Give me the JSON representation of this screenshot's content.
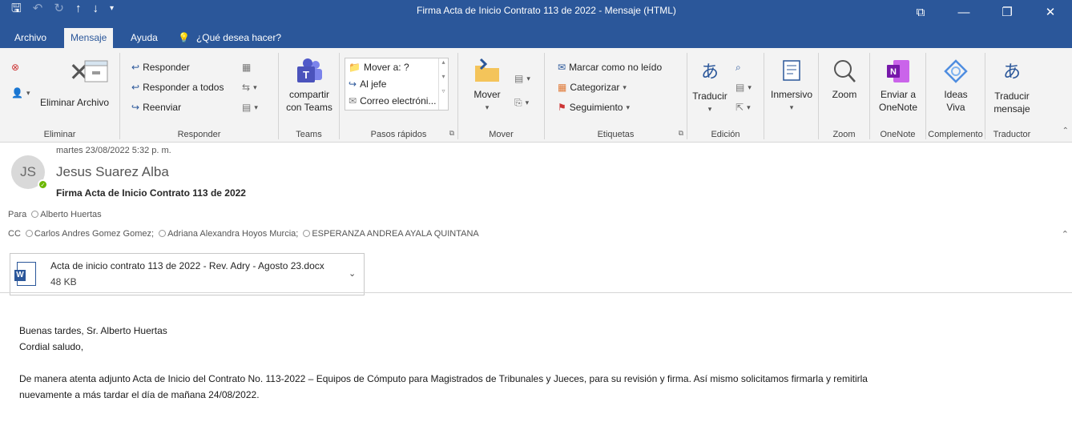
{
  "window": {
    "title": "Firma Acta de Inicio Contrato 113 de 2022  -  Mensaje (HTML)"
  },
  "tabs": {
    "archivo": "Archivo",
    "mensaje": "Mensaje",
    "ayuda": "Ayuda",
    "tell_me": "¿Qué desea hacer?"
  },
  "ribbon": {
    "eliminar": {
      "delete_label": "Eliminar Archivo",
      "group": "Eliminar"
    },
    "responder": {
      "reply": "Responder",
      "reply_all": "Responder a todos",
      "forward": "Reenviar",
      "group": "Responder"
    },
    "teams": {
      "share_line1": "compartir",
      "share_line2": "con Teams",
      "group": "Teams"
    },
    "quick_steps": {
      "items": [
        "Mover a: ?",
        "Al jefe",
        "Correo electróni..."
      ],
      "group": "Pasos rápidos"
    },
    "mover": {
      "move": "Mover",
      "group": "Mover"
    },
    "etiquetas": {
      "mark_unread": "Marcar como no leído",
      "categorize": "Categorizar",
      "followup": "Seguimiento",
      "group": "Etiquetas"
    },
    "edicion": {
      "translate": "Traducir",
      "group": "Edición"
    },
    "inmersivo": {
      "label": "Inmersivo"
    },
    "zoom": {
      "label": "Zoom",
      "group": "Zoom"
    },
    "onenote": {
      "line1": "Enviar a",
      "line2": "OneNote",
      "group": "OneNote"
    },
    "ideas": {
      "line1": "Ideas",
      "line2": "Viva",
      "group": "Complemento"
    },
    "traductor": {
      "line1": "Traducir",
      "line2": "mensaje",
      "group": "Traductor"
    }
  },
  "message": {
    "date": "martes 23/08/2022 5:32 p. m.",
    "initials": "JS",
    "sender": "Jesus Suarez Alba",
    "subject": "Firma Acta de Inicio Contrato 113 de 2022",
    "to_label": "Para",
    "to": "Alberto Huertas",
    "cc_label": "CC",
    "cc": [
      "Carlos Andres Gomez Gomez;",
      "Adriana Alexandra Hoyos Murcia;",
      "ESPERANZA ANDREA AYALA QUINTANA"
    ],
    "attachment": {
      "name": "Acta de inicio contrato  113 de 2022 - Rev. Adry - Agosto 23.docx",
      "size": "48 KB"
    }
  },
  "body": {
    "greeting": "Buenas tardes,  Sr. Alberto Huertas",
    "salutation": "Cordial saludo,",
    "paragraph_line1": "De manera atenta adjunto Acta de Inicio del Contrato No. 113-2022 – Equipos de Cómputo para Magistrados de Tribunales y Jueces, para su revisión y firma. Así mismo solicitamos firmarla y remitirla",
    "paragraph_line2": "nuevamente a más tardar el  día de  mañana 24/08/2022."
  },
  "colors": {
    "accent": "#2b579a",
    "teams": "#5059c9",
    "onenote": "#7719aa",
    "presence": "#6bb700"
  }
}
